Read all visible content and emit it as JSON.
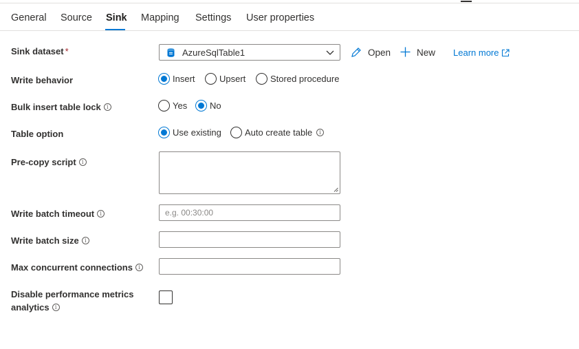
{
  "tabs": [
    {
      "label": "General"
    },
    {
      "label": "Source"
    },
    {
      "label": "Sink"
    },
    {
      "label": "Mapping"
    },
    {
      "label": "Settings"
    },
    {
      "label": "User properties"
    }
  ],
  "active_tab": "Sink",
  "sink_dataset": {
    "label": "Sink dataset",
    "required_mark": "*",
    "value": "AzureSqlTable1",
    "open_label": "Open",
    "new_label": "New",
    "learn_more_label": "Learn more"
  },
  "write_behavior": {
    "label": "Write behavior",
    "options": [
      "Insert",
      "Upsert",
      "Stored procedure"
    ],
    "selected": "Insert"
  },
  "bulk_insert_table_lock": {
    "label": "Bulk insert table lock",
    "options": [
      "Yes",
      "No"
    ],
    "selected": "No"
  },
  "table_option": {
    "label": "Table option",
    "options": [
      "Use existing",
      "Auto create table"
    ],
    "selected": "Use existing"
  },
  "pre_copy_script": {
    "label": "Pre-copy script",
    "value": ""
  },
  "write_batch_timeout": {
    "label": "Write batch timeout",
    "placeholder": "e.g. 00:30:00",
    "value": ""
  },
  "write_batch_size": {
    "label": "Write batch size",
    "value": ""
  },
  "max_concurrent_connections": {
    "label": "Max concurrent connections",
    "value": ""
  },
  "disable_perf_metrics": {
    "label_line1": "Disable performance metrics",
    "label_line2": "analytics",
    "checked": false
  },
  "colors": {
    "accent": "#0078d4",
    "text": "#323130",
    "border": "#8a8886",
    "required": "#a4262c"
  }
}
